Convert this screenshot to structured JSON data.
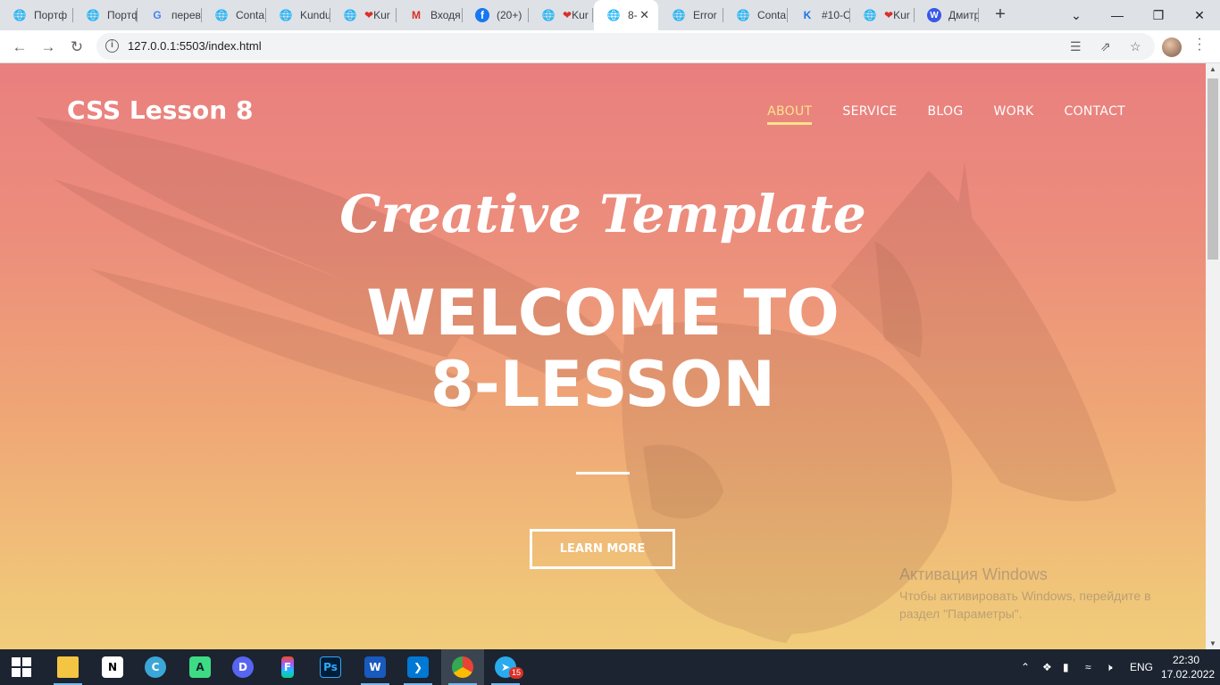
{
  "browser": {
    "tabs": [
      {
        "label": "Портф",
        "icon": "globe-icon"
      },
      {
        "label": "Портф",
        "icon": "globe-icon"
      },
      {
        "label": "перев",
        "icon": "google-icon"
      },
      {
        "label": "Conta",
        "icon": "globe-icon"
      },
      {
        "label": "Kundu",
        "icon": "globe-icon"
      },
      {
        "label": "Kur",
        "icon": "heart-icon"
      },
      {
        "label": "Входя",
        "icon": "gmail-icon"
      },
      {
        "label": "(20+) ",
        "icon": "facebook-icon"
      },
      {
        "label": "Kur",
        "icon": "heart-icon"
      },
      {
        "label": "8-",
        "icon": "globe-icon"
      },
      {
        "label": "Error",
        "icon": "globe-icon"
      },
      {
        "label": "Conta",
        "icon": "globe-icon"
      },
      {
        "label": "#10-C",
        "icon": "k-icon"
      },
      {
        "label": "Kur",
        "icon": "heart-icon"
      },
      {
        "label": "Дмитр",
        "icon": "wordpress-icon"
      }
    ],
    "url": "127.0.0.1:5503/index.html"
  },
  "site": {
    "logo": "CSS Lesson 8",
    "nav": [
      "ABOUT",
      "SERVICE",
      "BLOG",
      "WORK",
      "CONTACT"
    ],
    "active_nav": "ABOUT",
    "hero_script": "Creative Template",
    "hero_title_line1": "WELCOME TO",
    "hero_title_line2": "8-LESSON",
    "cta": "LEARN MORE"
  },
  "watermark": {
    "title": "Активация Windows",
    "text": "Чтобы активировать Windows, перейдите в раздел \"Параметры\"."
  },
  "taskbar": {
    "apps": [
      "file-explorer",
      "notion",
      "canva",
      "android-studio",
      "discord",
      "figma",
      "photoshop",
      "word",
      "vscode",
      "chrome",
      "telegram"
    ],
    "telegram_badge": "15",
    "language": "ENG",
    "time": "22:30",
    "date": "17.02.2022"
  },
  "colors": {
    "accent_nav": "#fce38a",
    "gradient_top": "#e97f7f",
    "gradient_bottom": "#f1cc7b"
  }
}
